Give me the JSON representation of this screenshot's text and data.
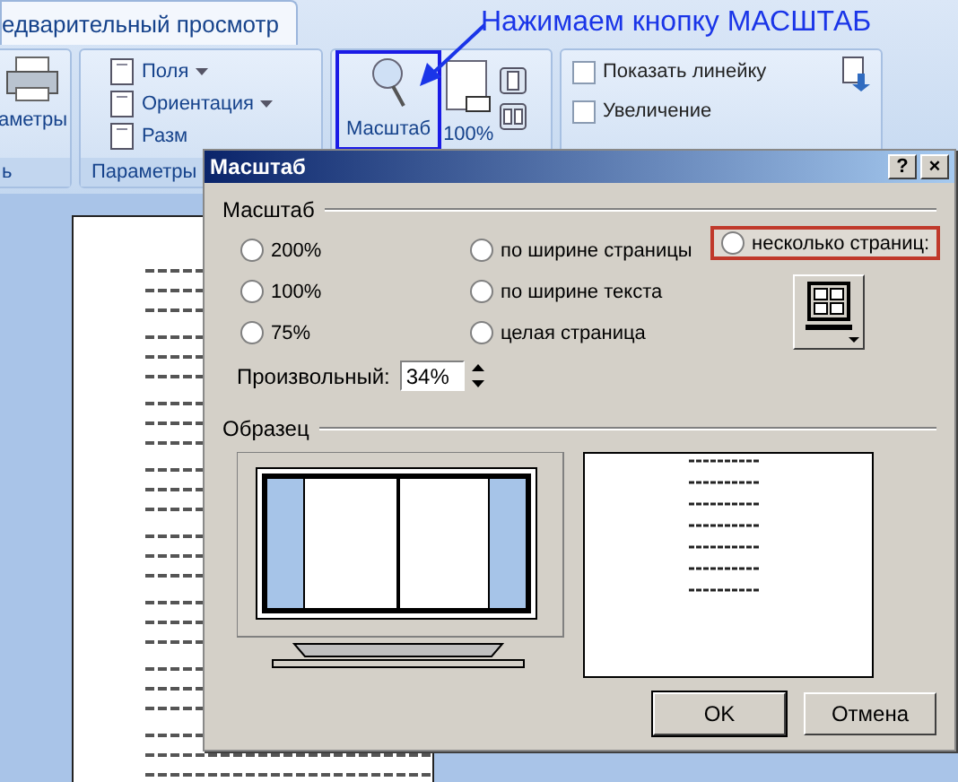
{
  "ribbon": {
    "tab": {
      "label": "едварительный просмотр",
      "selected": true
    },
    "groups": [
      {
        "kind": "print",
        "button": "аметры",
        "label": "ь"
      },
      {
        "kind": "list",
        "items": [
          {
            "label": "Поля",
            "dropdown": true
          },
          {
            "label": "Ориентация",
            "dropdown": true
          },
          {
            "label": "Разм",
            "dropdown": false
          }
        ],
        "label": "Параметры"
      },
      {
        "kind": "zoom",
        "buttons": [
          {
            "label": "Масштаб",
            "highlighted": true
          },
          {
            "label": "100%",
            "highlighted": false
          }
        ]
      },
      {
        "kind": "checks",
        "items": [
          {
            "label": "Показать линейку",
            "checked": false
          },
          {
            "label": "Увеличение",
            "checked": false
          }
        ]
      }
    ]
  },
  "annotation": {
    "text": "Нажимаем кнопку МАСШТАБ"
  },
  "dialog": {
    "title": "Масштаб",
    "help": "?",
    "close": "×",
    "zoom_group": {
      "label": "Масштаб",
      "options": [
        {
          "label": "200%",
          "selected": false,
          "highlighted": false
        },
        {
          "label": "по ширине страницы",
          "selected": false,
          "highlighted": false
        },
        {
          "label": "несколько страниц:",
          "selected": false,
          "highlighted": true
        },
        {
          "label": "100%",
          "selected": false,
          "highlighted": false
        },
        {
          "label": "по ширине текста",
          "selected": false,
          "highlighted": false
        },
        {
          "label": "75%",
          "selected": false,
          "highlighted": false
        },
        {
          "label": "целая страница",
          "selected": false,
          "highlighted": false
        }
      ],
      "custom": {
        "label": "Произвольный:",
        "value": "34%"
      }
    },
    "sample_group": {
      "label": "Образец"
    },
    "buttons": [
      "OK",
      "Отмена"
    ]
  }
}
